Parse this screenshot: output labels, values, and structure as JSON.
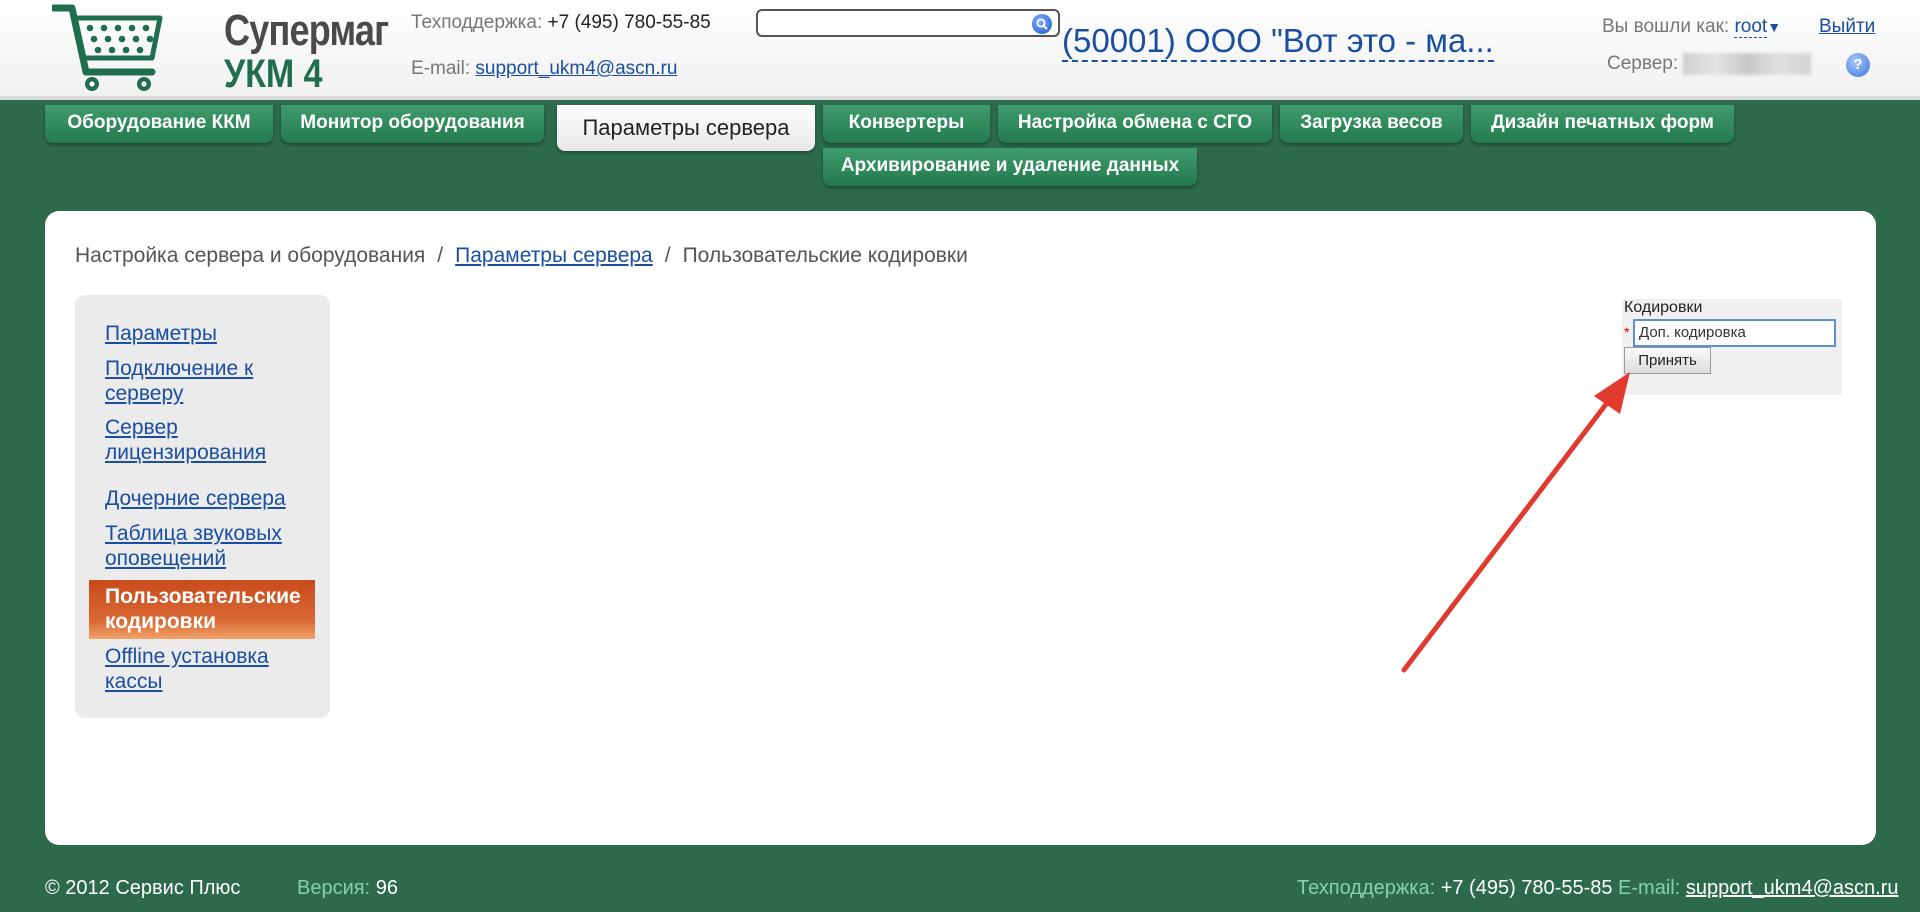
{
  "header": {
    "logo": {
      "line1": "Супермаг",
      "line2": "УКМ 4"
    },
    "support_label": "Техподдержка:",
    "support_phone": "+7 (495) 780-55-85",
    "email_label": "E-mail:",
    "email": "support_ukm4@ascn.ru",
    "search": {
      "value": "",
      "placeholder": ""
    },
    "org_name": "(50001) ООО \"Вот это - ма...",
    "logged_in_label": "Вы вошли как:",
    "user": "root",
    "logout": "Выйти",
    "server_label": "Сервер:",
    "help": "?"
  },
  "tabs": [
    {
      "label": "Оборудование ККМ"
    },
    {
      "label": "Монитор оборудования"
    },
    {
      "label": "Параметры сервера",
      "active": true
    },
    {
      "label": "Конвертеры"
    },
    {
      "label": "Настройка обмена с СГО"
    },
    {
      "label": "Загрузка весов"
    },
    {
      "label": "Дизайн печатных форм"
    },
    {
      "label": "Архивирование и удаление данных"
    }
  ],
  "breadcrumb": {
    "root": "Настройка сервера и оборудования",
    "parent": "Параметры сервера",
    "current": "Пользовательские кодировки",
    "separator": "/"
  },
  "sidebar": {
    "items": [
      {
        "label": "Параметры"
      },
      {
        "label": "Подключение к серверу"
      },
      {
        "label": "Сервер лицензирования"
      },
      {
        "label": "Дочерние сервера"
      },
      {
        "label": "Таблица звуковых оповещений"
      },
      {
        "label": "Пользовательские кодировки",
        "active": true
      },
      {
        "label": "Offline установка кассы"
      }
    ]
  },
  "encodings_panel": {
    "title": "Кодировки",
    "required_mark": "*",
    "input_value": "Доп. кодировка",
    "submit": "Принять"
  },
  "footer": {
    "copyright": "© 2012 Сервис Плюс",
    "version_label": "Версия:",
    "version": "96",
    "support_label": "Техподдержка:",
    "support_phone": "+7 (495) 780-55-85",
    "email_label": "E-mail:",
    "email": "support_ukm4@ascn.ru"
  },
  "colors": {
    "background": "#2d6a4c",
    "tab": "#2e8a5b",
    "link": "#1a4fa0",
    "active_sidebar": "#d2582a",
    "annotation_arrow": "#e03b2e"
  }
}
